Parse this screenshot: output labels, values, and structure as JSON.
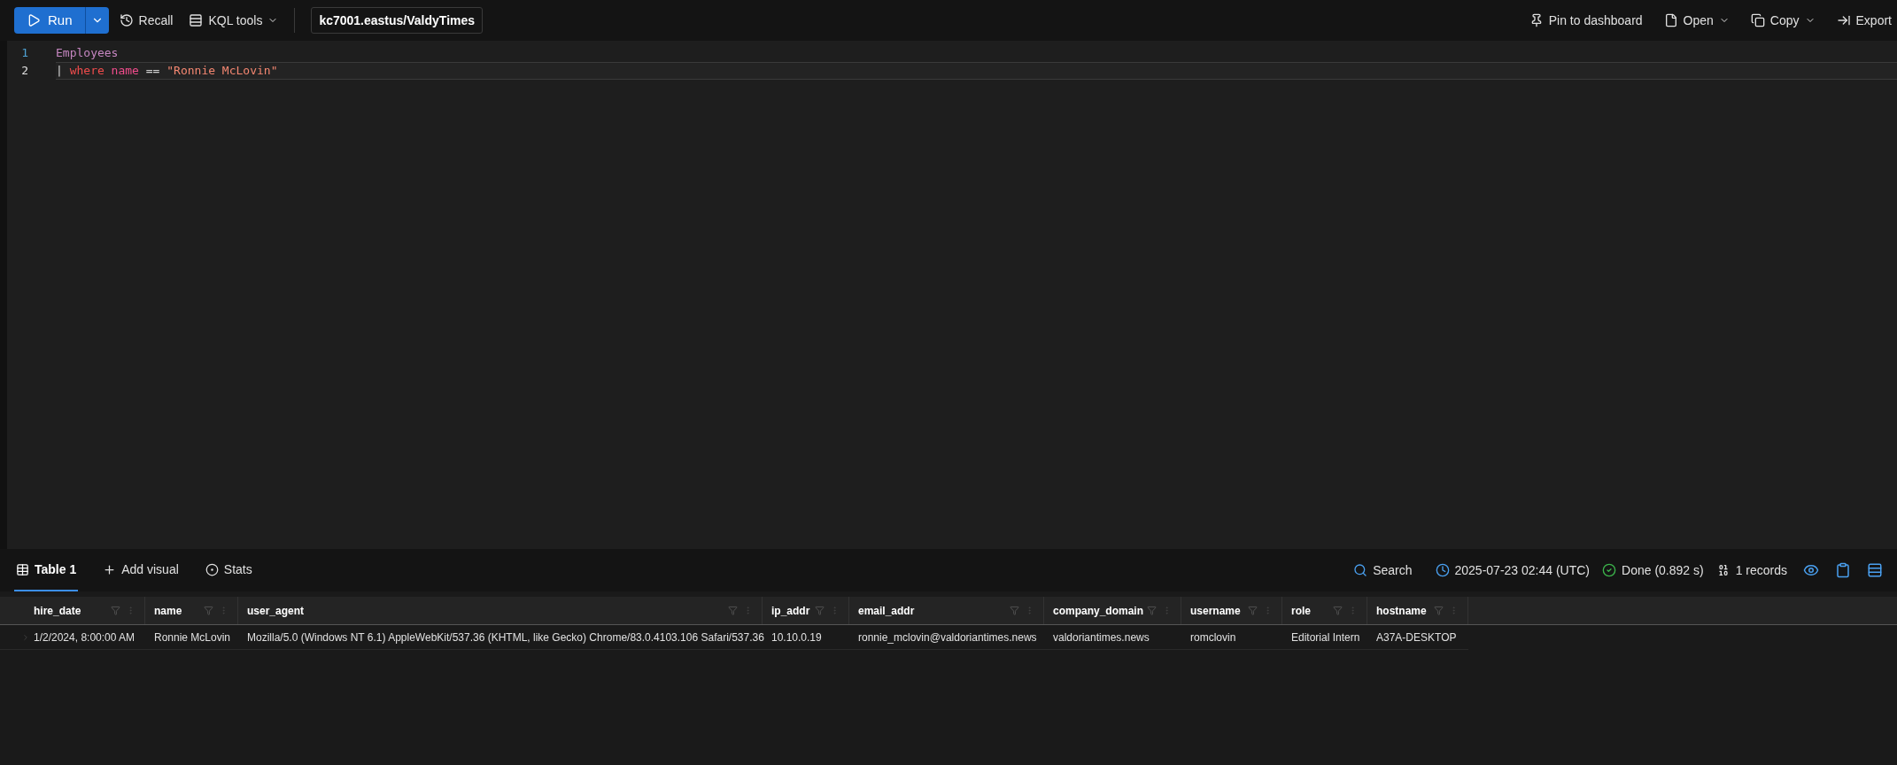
{
  "toolbar": {
    "run": "Run",
    "recall": "Recall",
    "kql_tools": "KQL tools",
    "database": "kc7001.eastus/ValdyTimes",
    "actions": [
      {
        "label": "Pin to dashboard",
        "kind": "pin",
        "dropdown": false
      },
      {
        "label": "Open",
        "kind": "file",
        "dropdown": true
      },
      {
        "label": "Copy",
        "kind": "copy",
        "dropdown": true
      },
      {
        "label": "Export",
        "kind": "export",
        "dropdown": false
      }
    ]
  },
  "editor": {
    "lines": [
      {
        "number": "1",
        "current": false,
        "tokens": [
          {
            "text": "Employees",
            "kind": "table"
          }
        ]
      },
      {
        "number": "2",
        "current": true,
        "tokens": [
          {
            "text": "| ",
            "kind": "pipe"
          },
          {
            "text": "where",
            "kind": "keyword"
          },
          {
            "text": " name",
            "kind": "column"
          },
          {
            "text": " == ",
            "kind": "operator"
          },
          {
            "text": "\"Ronnie McLovin\"",
            "kind": "string"
          }
        ]
      }
    ]
  },
  "results": {
    "tabs": [
      {
        "label": "Table 1",
        "kind": "table",
        "selected": true
      },
      {
        "label": "Add visual",
        "kind": "add",
        "selected": false
      },
      {
        "label": "Stats",
        "kind": "stats",
        "selected": false
      }
    ],
    "search": "Search",
    "timestamp": "2025-07-23 02:44 (UTC)",
    "status": "Done (0.892 s)",
    "records": "1 records",
    "table": {
      "columns": [
        "hire_date",
        "name",
        "user_agent",
        "ip_addr",
        "email_addr",
        "company_domain",
        "username",
        "role",
        "hostname"
      ],
      "rows": [
        [
          "1/2/2024, 8:00:00 AM",
          "Ronnie McLovin",
          "Mozilla/5.0 (Windows NT 6.1) AppleWebKit/537.36 (KHTML, like Gecko) Chrome/83.0.4103.106 Safari/537.36",
          "10.10.0.19",
          "ronnie_mclovin@valdoriantimes.news",
          "valdoriantimes.news",
          "romclovin",
          "Editorial Intern",
          "A37A-DESKTOP"
        ]
      ]
    }
  }
}
